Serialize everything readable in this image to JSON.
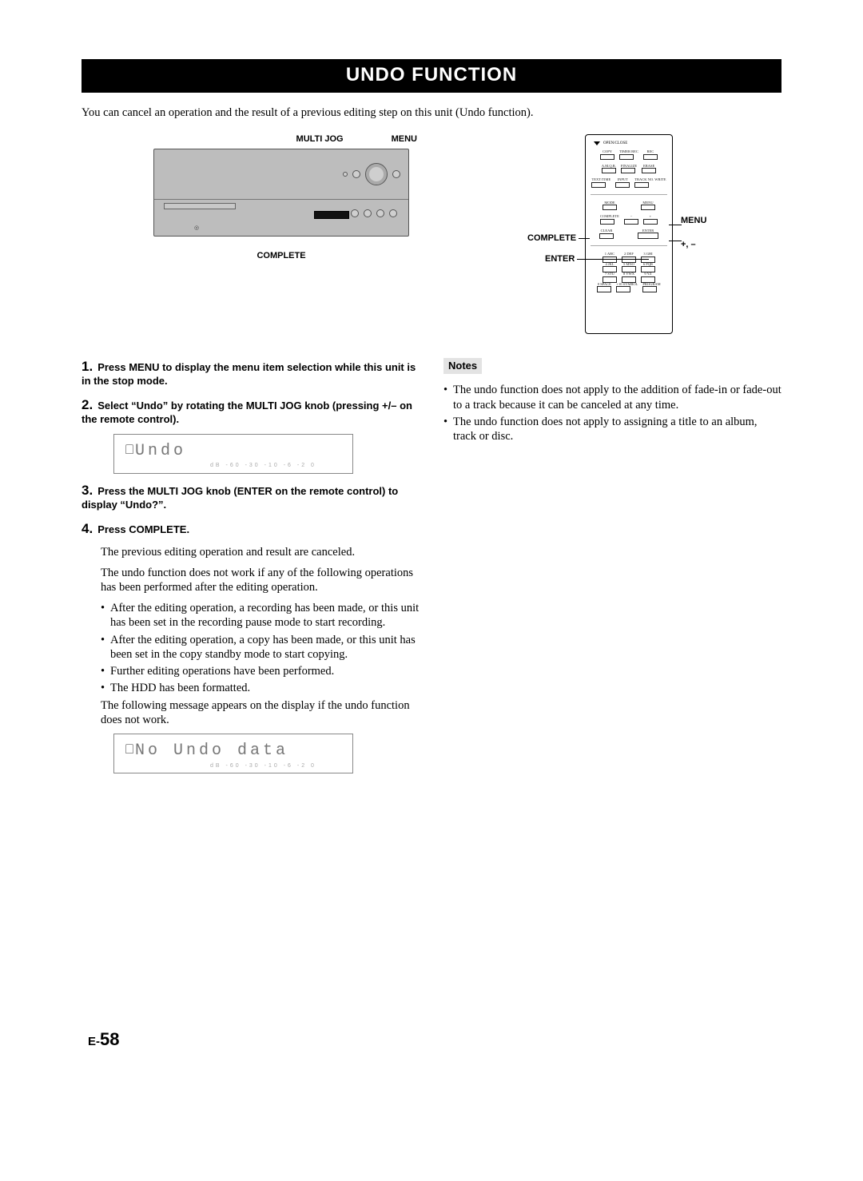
{
  "title": "UNDO FUNCTION",
  "intro": "You can cancel an operation and the result of a previous editing step on this unit (Undo function).",
  "unit_labels": {
    "multi_jog": "MULTI JOG",
    "menu": "MENU",
    "complete": "COMPLETE"
  },
  "remote": {
    "open_close": "OPEN/CLOSE",
    "row1": [
      "COPY",
      "TIMER REC",
      "REC"
    ],
    "row2": [
      "A.M.Q.R.",
      "FINALIZE",
      "ERASE"
    ],
    "row3": [
      "TEXT/TIME",
      "INPUT",
      "TRACK NO. WRITE"
    ],
    "row4": [
      "MODE",
      "MENU"
    ],
    "row5": [
      "COMPLETE",
      "−",
      "+"
    ],
    "row6": [
      "CLEAR",
      "ENTER"
    ],
    "nums": [
      [
        "1  ABC",
        "2  DEF",
        "3  GHI"
      ],
      [
        "4  JKL",
        "5  MNO",
        "6  PQR"
      ],
      [
        "7  STU",
        "8  VWX",
        "9  YZ"
      ],
      [
        "0 SPACE",
        "+10 SYMBOL",
        "PROGRAM"
      ]
    ],
    "callouts": {
      "menu": "MENU",
      "complete": "COMPLETE",
      "enter": "ENTER",
      "plus_minus": "+, –"
    }
  },
  "steps": {
    "s1": "Press MENU to display the menu item selection while this unit is in the stop mode.",
    "s2": "Select “Undo” by rotating the MULTI JOG knob (pressing +/– on the remote control).",
    "s3": "Press the MULTI JOG knob (ENTER on the remote control) to display “Undo?”.",
    "s4_title": "Press COMPLETE.",
    "s4_line1": "The previous editing operation and result are canceled.",
    "s4_line2": "The undo function does not work if any of the following operations has been performed after the editing operation.",
    "s4_bullets": [
      "After the editing operation, a recording has been made, or this unit has been set in the recording pause mode to start recording.",
      "After the editing operation, a copy has been made, or this unit has been set in the copy standby mode to start copying.",
      "Further editing operations have been performed.",
      "The HDD has been formatted."
    ],
    "s4_line3": "The following message appears on the display if the undo function does not work."
  },
  "lcd": {
    "undo": "Undo",
    "no_undo": "No Undo data",
    "subscale": "dB  -60    -30    -10    -6    -2    0"
  },
  "notes": {
    "heading": "Notes",
    "items": [
      "The undo function does not apply to the addition of fade-in or fade-out to a track because it can be canceled at any time.",
      "The undo function does not apply to assigning a title to an album, track or disc."
    ]
  },
  "page_number": {
    "prefix": "E-",
    "number": "58"
  }
}
